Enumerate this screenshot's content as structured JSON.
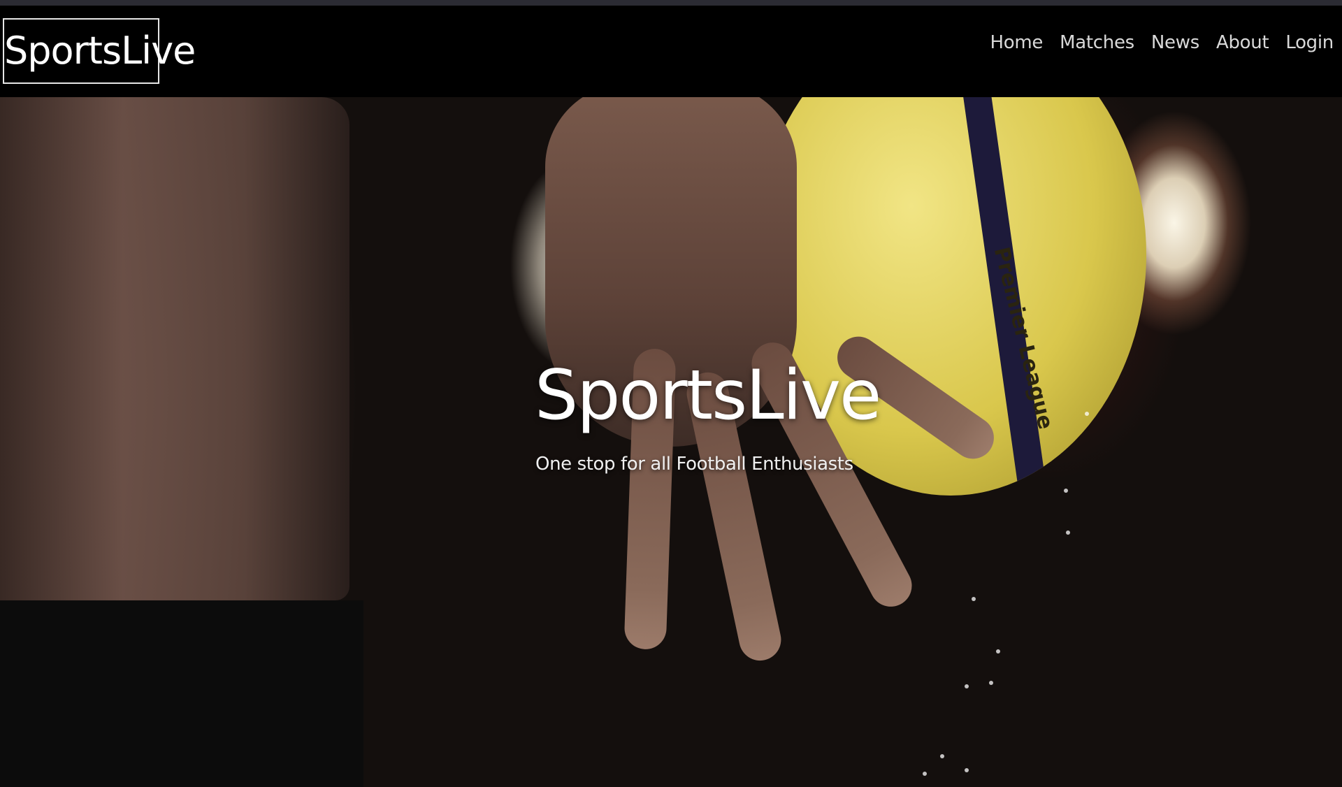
{
  "brand": {
    "name": "SportsLive"
  },
  "nav": {
    "items": [
      {
        "label": "Home"
      },
      {
        "label": "Matches"
      },
      {
        "label": "News"
      },
      {
        "label": "About"
      },
      {
        "label": "Login"
      }
    ]
  },
  "hero": {
    "title": "SportsLive",
    "subtitle": "One stop for all Football Enthusiasts",
    "image_text": "Premier League"
  }
}
